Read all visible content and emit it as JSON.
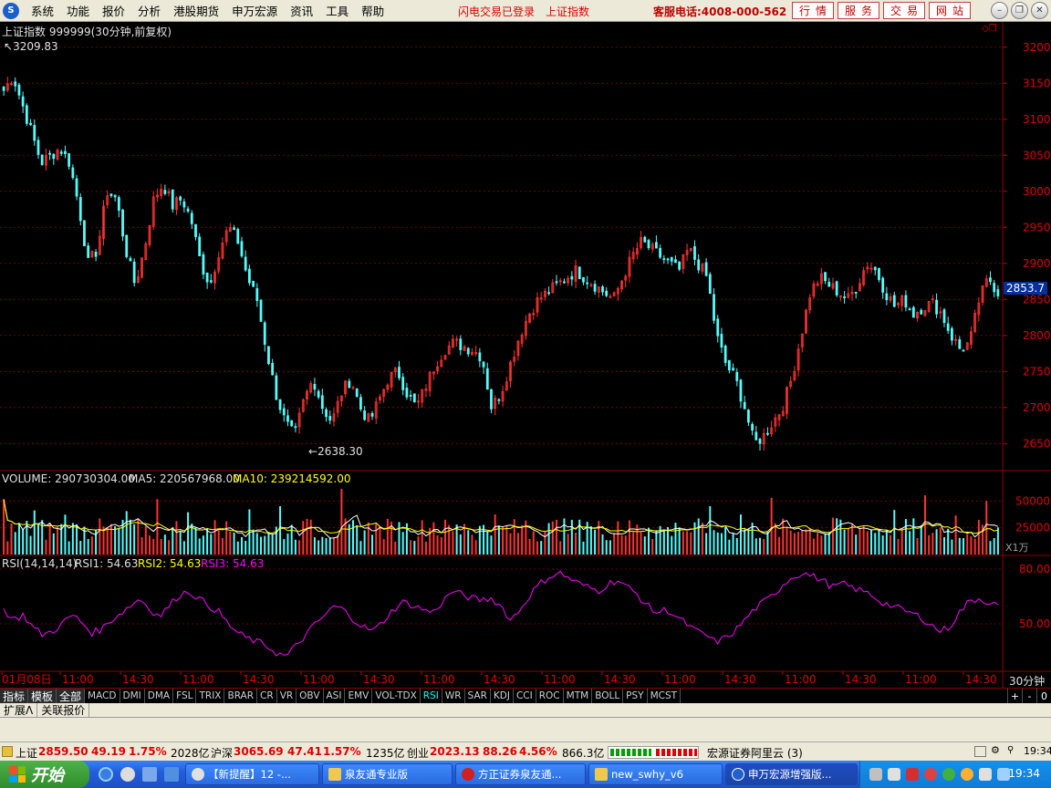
{
  "menubar": {
    "items": [
      "系统",
      "功能",
      "报价",
      "分析",
      "港股期货",
      "申万宏源",
      "资讯",
      "工具",
      "帮助"
    ],
    "status_login": "闪电交易已登录",
    "status_index": "上证指数",
    "hotline": "客服电话:4008-000-562",
    "service_buttons": [
      "行情",
      "服务",
      "交易",
      "网站"
    ]
  },
  "chart_header": {
    "title": "上证指数 999999(30分钟,前复权)",
    "high_marker": "3209.83",
    "low_marker": "2638.30",
    "current_price": "2853.7"
  },
  "volume_header": {
    "volume_label": "VOLUME: 290730304.00",
    "ma5_label": "MA5: 220567968.00",
    "ma10_label": "MA10: 239214592.00",
    "unit_label": "X1万"
  },
  "rsi_header": {
    "params": "RSI(14,14,14)",
    "rsi1": "RSI1: 54.63",
    "rsi2": "RSI2: 54.63",
    "rsi3": "RSI3: 54.63"
  },
  "chart_data": {
    "type": "candlestick",
    "price_axis": {
      "ticks": [
        "3200",
        "3150",
        "3100",
        "3050",
        "3000",
        "2950",
        "2900",
        "2850",
        "2800",
        "2750",
        "2700",
        "2650"
      ],
      "ylim": [
        2620,
        3225
      ]
    },
    "volume_axis": {
      "ticks": [
        "50000",
        "25000"
      ]
    },
    "rsi_axis": {
      "ticks": [
        "80.00",
        "50.00"
      ]
    },
    "x_labels": [
      "01月08日",
      "11:00",
      "14:30",
      "11:00",
      "14:30",
      "11:00",
      "14:30",
      "11:00",
      "14:30",
      "11:00",
      "14:30",
      "11:00",
      "14:30",
      "11:00",
      "14:30",
      "11:00",
      "14:30"
    ],
    "period_label": "30分钟",
    "close_path": [
      3140,
      3160,
      3120,
      3080,
      3040,
      3050,
      3060,
      3040,
      2980,
      2900,
      2920,
      3000,
      2990,
      2920,
      2870,
      2920,
      2990,
      3010,
      2980,
      2990,
      2960,
      2900,
      2870,
      2920,
      2950,
      2930,
      2880,
      2850,
      2780,
      2720,
      2680,
      2660,
      2710,
      2740,
      2700,
      2680,
      2720,
      2740,
      2700,
      2680,
      2710,
      2740,
      2750,
      2720,
      2700,
      2730,
      2760,
      2780,
      2790,
      2785,
      2780,
      2770,
      2700,
      2720,
      2760,
      2800,
      2830,
      2850,
      2860,
      2870,
      2880,
      2890,
      2880,
      2870,
      2860,
      2850,
      2880,
      2910,
      2930,
      2920,
      2910,
      2900,
      2890,
      2920,
      2900,
      2880,
      2800,
      2760,
      2740,
      2700,
      2650,
      2660,
      2680,
      2700,
      2740,
      2800,
      2860,
      2880,
      2870,
      2860,
      2850,
      2870,
      2900,
      2890,
      2860,
      2840,
      2850,
      2830,
      2840,
      2845,
      2830,
      2800,
      2780,
      2790,
      2850,
      2880,
      2860
    ],
    "rsi_path": [
      58,
      52,
      55,
      48,
      44,
      46,
      50,
      55,
      51,
      45,
      47,
      52,
      56,
      60,
      64,
      58,
      54,
      60,
      66,
      68,
      64,
      60,
      57,
      50,
      45,
      42,
      40,
      38,
      34,
      32,
      38,
      44,
      50,
      55,
      60,
      57,
      52,
      48,
      46,
      52,
      58,
      62,
      60,
      58,
      56,
      62,
      68,
      66,
      64,
      63,
      64,
      60,
      52,
      58,
      66,
      72,
      76,
      78,
      75,
      72,
      70,
      68,
      72,
      74,
      70,
      66,
      60,
      56,
      58,
      54,
      50,
      46,
      44,
      40,
      42,
      46,
      52,
      58,
      62,
      66,
      72,
      76,
      78,
      76,
      74,
      70,
      72,
      70,
      68,
      66,
      62,
      60,
      58,
      56,
      54,
      50,
      46,
      48,
      56,
      62,
      64,
      62,
      60
    ],
    "series": [
      {
        "name": "RSI1"
      }
    ]
  },
  "indicator_tabs": [
    "指标",
    "模板",
    "全部",
    "MACD",
    "DMI",
    "DMA",
    "FSL",
    "TRIX",
    "BRAR",
    "CR",
    "VR",
    "OBV",
    "ASI",
    "EMV",
    "VOL-TDX",
    "RSI",
    "WR",
    "SAR",
    "KDJ",
    "CCI",
    "ROC",
    "MTM",
    "BOLL",
    "PSY",
    "MCST"
  ],
  "active_indicator": "RSI",
  "zoom_buttons": [
    "+",
    "-",
    "0"
  ],
  "sub_tabs": [
    "扩展Λ",
    "关联报价"
  ],
  "statusbar": {
    "sh_label": "上证",
    "sh_value": "2859.50",
    "sh_change": "49.19",
    "sh_pct": "1.75%",
    "sh_amount": "2028亿",
    "hs_label": "沪深",
    "hs_value": "3065.69",
    "hs_change": "47.41",
    "hs_pct": "1.57%",
    "hs_amount": "1235亿",
    "cy_label": "创业",
    "cy_value": "2023.13",
    "cy_change": "88.26",
    "cy_pct": "4.56%",
    "cy_amount": "866.3亿",
    "server": "宏源证券阿里云 (3)"
  },
  "taskbar": {
    "start_label": "开始",
    "tasks": [
      "【新提醒】12 -...",
      "泉友通专业版",
      "方正证券泉友通...",
      "new_swhy_v6",
      "申万宏源增强版..."
    ],
    "clock": "19:34"
  }
}
